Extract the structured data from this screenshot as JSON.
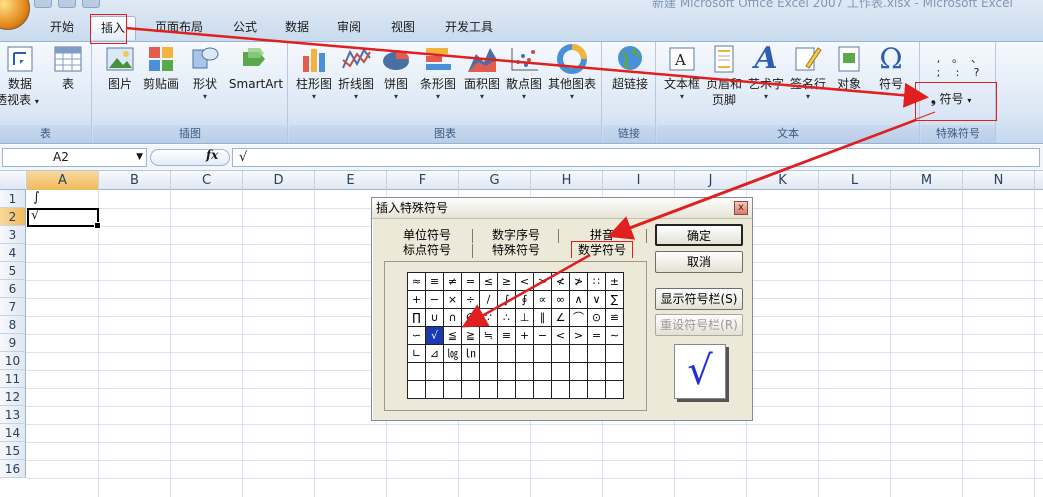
{
  "window": {
    "title": "新建 Microsoft Office Excel 2007 工作表.xlsx - Microsoft Excel"
  },
  "tabs": [
    "开始",
    "插入",
    "页面布局",
    "公式",
    "数据",
    "审阅",
    "视图",
    "开发工具"
  ],
  "active_tab": "插入",
  "ribbon": {
    "groups": {
      "table": "表",
      "illustrations": "插图",
      "charts": "图表",
      "links": "链接",
      "text": "文本",
      "special_symbols": "特殊符号"
    },
    "buttons": {
      "pivot_line1": "数据",
      "pivot_line2": "透视表",
      "table": "表",
      "picture": "图片",
      "clipart": "剪贴画",
      "shapes": "形状",
      "smartart": "SmartArt",
      "column": "柱形图",
      "line": "折线图",
      "pie": "饼图",
      "bar": "条形图",
      "area": "面积图",
      "scatter": "散点图",
      "other_charts": "其他图表",
      "hyperlink": "超链接",
      "textbox": "文本框",
      "header_line1": "页眉和",
      "header_line2": "页脚",
      "wordart": "艺术字",
      "signature": "签名行",
      "object": "对象",
      "symbol": "符号",
      "special_symbol": "符号",
      "special_symbol_glyph": "❟"
    },
    "symbol_preview": [
      ",",
      "。",
      "、",
      ";",
      ":",
      "?"
    ]
  },
  "formula_bar": {
    "name_box": "A2",
    "fx": "fx",
    "content": "√"
  },
  "sheet": {
    "columns": [
      "A",
      "B",
      "C",
      "D",
      "E",
      "F",
      "G",
      "H",
      "I",
      "J",
      "K",
      "L",
      "M",
      "N"
    ],
    "rows": [
      "1",
      "2",
      "3",
      "4",
      "5",
      "6",
      "7",
      "8",
      "9",
      "10",
      "11",
      "12",
      "13",
      "14",
      "15",
      "16"
    ],
    "cells": {
      "A1": "∫",
      "A2": "√"
    }
  },
  "dialog": {
    "title": "插入特殊符号",
    "close": "x",
    "tabs_row1": [
      "单位符号",
      "数字序号",
      "拼音"
    ],
    "tabs_row2": [
      "标点符号",
      "特殊符号",
      "数学符号"
    ],
    "active_tab": "数学符号",
    "symbols": [
      [
        "≈",
        "≡",
        "≠",
        "=",
        "≤",
        "≥",
        "<",
        ">",
        "≮",
        "≯",
        "∷",
        "±"
      ],
      [
        "+",
        "−",
        "×",
        "÷",
        "/",
        "∫",
        "∮",
        "∝",
        "∞",
        "∧",
        "∨",
        "∑"
      ],
      [
        "∏",
        "∪",
        "∩",
        "∈",
        "∵",
        "∴",
        "⊥",
        "∥",
        "∠",
        "⌒",
        "⊙",
        "≌"
      ],
      [
        "∽",
        "√",
        "≦",
        "≧",
        "≒",
        "≡",
        "+",
        "−",
        "<",
        ">",
        "=",
        "∼"
      ],
      [
        "∟",
        "⊿",
        "㏒",
        "㏑",
        "",
        "",
        "",
        "",
        "",
        "",
        "",
        ""
      ],
      [
        "",
        "",
        "",
        "",
        "",
        "",
        "",
        "",
        "",
        "",
        "",
        ""
      ],
      [
        "",
        "",
        "",
        "",
        "",
        "",
        "",
        "",
        "",
        "",
        "",
        ""
      ]
    ],
    "selected_symbol": "√",
    "buttons": {
      "ok": "确定",
      "cancel": "取消",
      "show_bar": "显示符号栏(S)",
      "reset_bar": "重设符号栏(R)"
    },
    "preview": "√"
  },
  "colors": {
    "highlight": "#e02020",
    "selection": "#1a3ab0",
    "ribbon": "#dbe7f5"
  }
}
